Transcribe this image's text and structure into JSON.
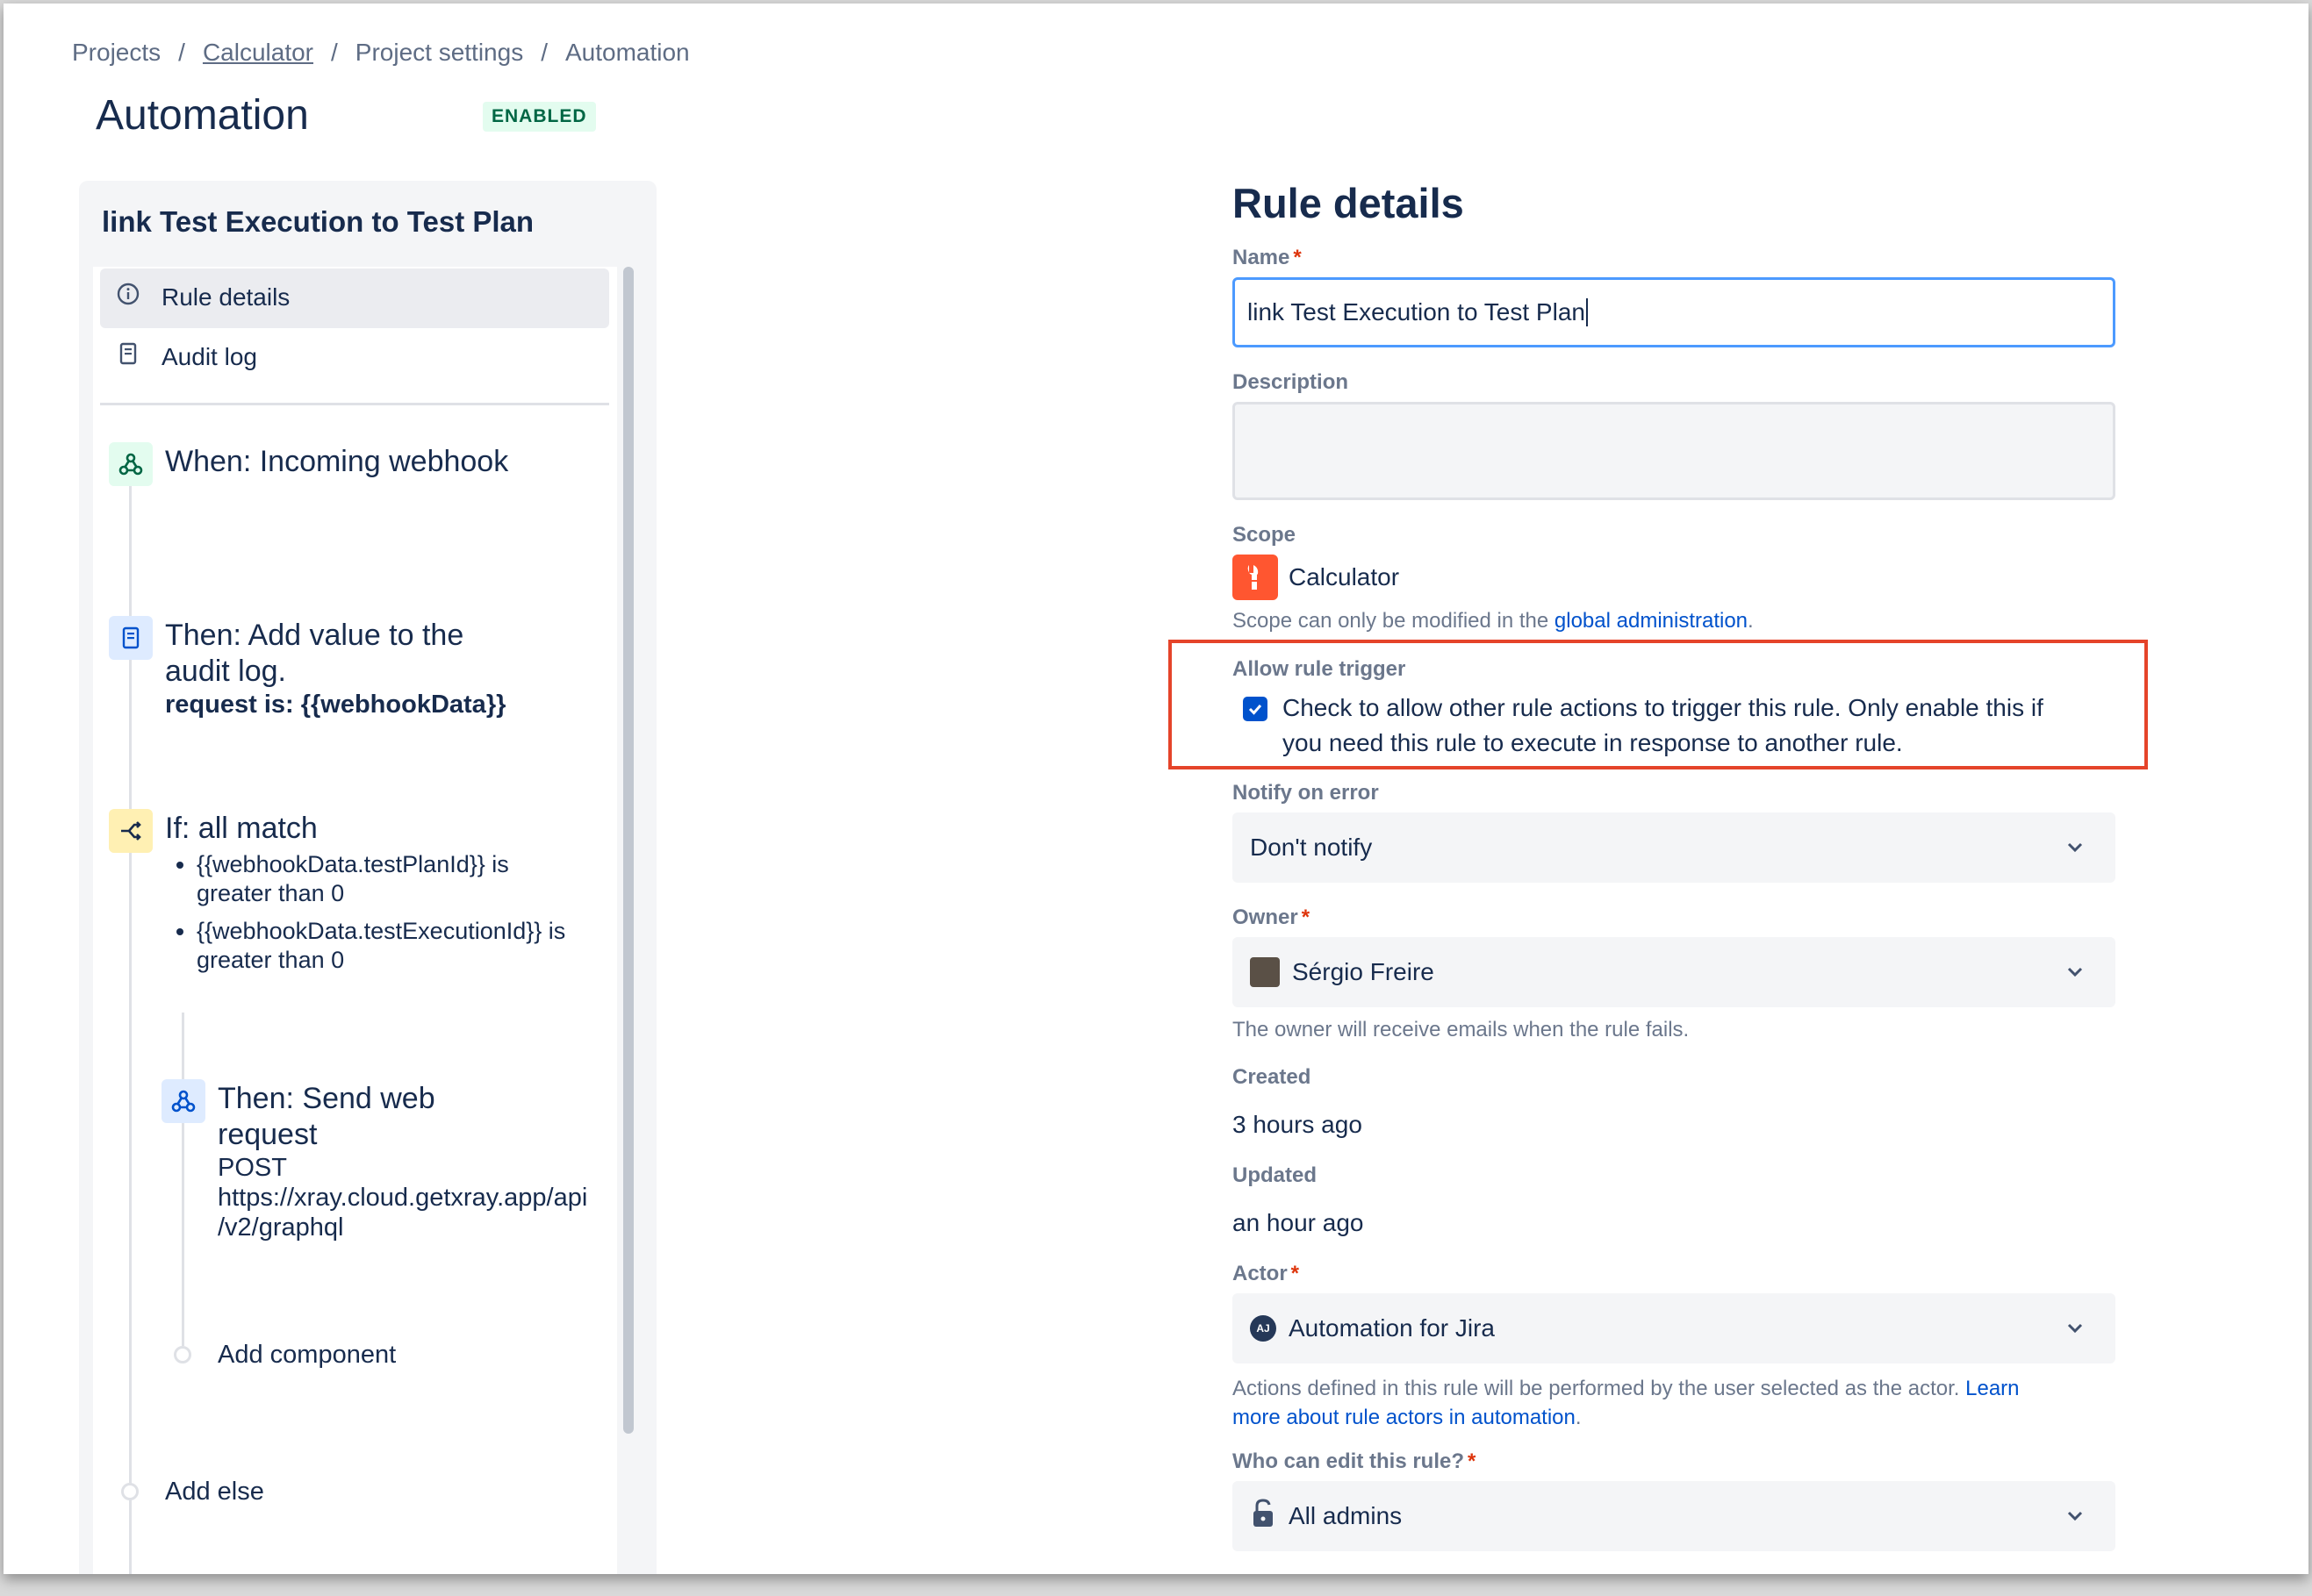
{
  "breadcrumb": {
    "items": [
      "Projects",
      "Calculator",
      "Project settings",
      "Automation"
    ],
    "separator": "/"
  },
  "header": {
    "title": "Automation",
    "status_badge": "ENABLED"
  },
  "sidebar": {
    "rule_title": "link Test Execution to Test Plan",
    "nav": [
      {
        "label": "Rule details",
        "icon": "info-icon",
        "active": true
      },
      {
        "label": "Audit log",
        "icon": "audit-log-icon",
        "active": false
      }
    ],
    "components": {
      "trigger": {
        "title": "When: Incoming webhook",
        "icon": "webhook-icon"
      },
      "log_action": {
        "title_line1": "Then: Add value to the",
        "title_line2": "audit log.",
        "detail": "request is: {{webhookData}}",
        "icon": "audit-log-icon"
      },
      "condition": {
        "title": "If: all match",
        "icon": "branch-icon",
        "conditions": [
          {
            "line1": "{{webhookData.testPlanId}} is",
            "line2": "greater than 0"
          },
          {
            "line1": "{{webhookData.testExecutionId}} is",
            "line2": "greater than 0"
          }
        ]
      },
      "web_request": {
        "title_line1": "Then: Send web",
        "title_line2": "request",
        "method": "POST",
        "url_line1": "https://xray.cloud.getxray.app/api",
        "url_line2": "/v2/graphql",
        "icon": "webhook-icon"
      },
      "add_component": "Add component",
      "add_else": "Add else"
    }
  },
  "form": {
    "heading": "Rule details",
    "name": {
      "label": "Name",
      "required_mark": "*",
      "value": "link Test Execution to Test Plan"
    },
    "description": {
      "label": "Description",
      "value": ""
    },
    "scope": {
      "label": "Scope",
      "project": "Calculator",
      "helper_prefix": "Scope can only be modified in the ",
      "helper_link": "global administration",
      "helper_suffix": "."
    },
    "allow_rule_trigger": {
      "label": "Allow rule trigger",
      "checked": true,
      "text_line1": "Check to allow other rule actions to trigger this rule. Only enable this if",
      "text_line2": "you need this rule to execute in response to another rule."
    },
    "notify_on_error": {
      "label": "Notify on error",
      "value": "Don't notify"
    },
    "owner": {
      "label": "Owner",
      "required_mark": "*",
      "value": "Sérgio Freire",
      "helper": "The owner will receive emails when the rule fails."
    },
    "created": {
      "label": "Created",
      "value": "3 hours ago"
    },
    "updated": {
      "label": "Updated",
      "value": "an hour ago"
    },
    "actor": {
      "label": "Actor",
      "required_mark": "*",
      "value": "Automation for Jira",
      "avatar_initials": "AJ",
      "helper_line1_prefix": "Actions defined in this rule will be performed by the user selected as the actor. ",
      "helper_line1_link": "Learn",
      "helper_line2_link": "more about rule actors in automation",
      "helper_line2_suffix": "."
    },
    "who_can_edit": {
      "label": "Who can edit this rule?",
      "required_mark": "*",
      "value": "All admins"
    }
  },
  "colors": {
    "accent": "#0052cc",
    "focus_border": "#4c9aff",
    "highlight_box": "#e5442a",
    "enabled_badge_bg": "#e3fcef",
    "enabled_badge_text": "#006644",
    "project_icon": "#ff5630"
  }
}
